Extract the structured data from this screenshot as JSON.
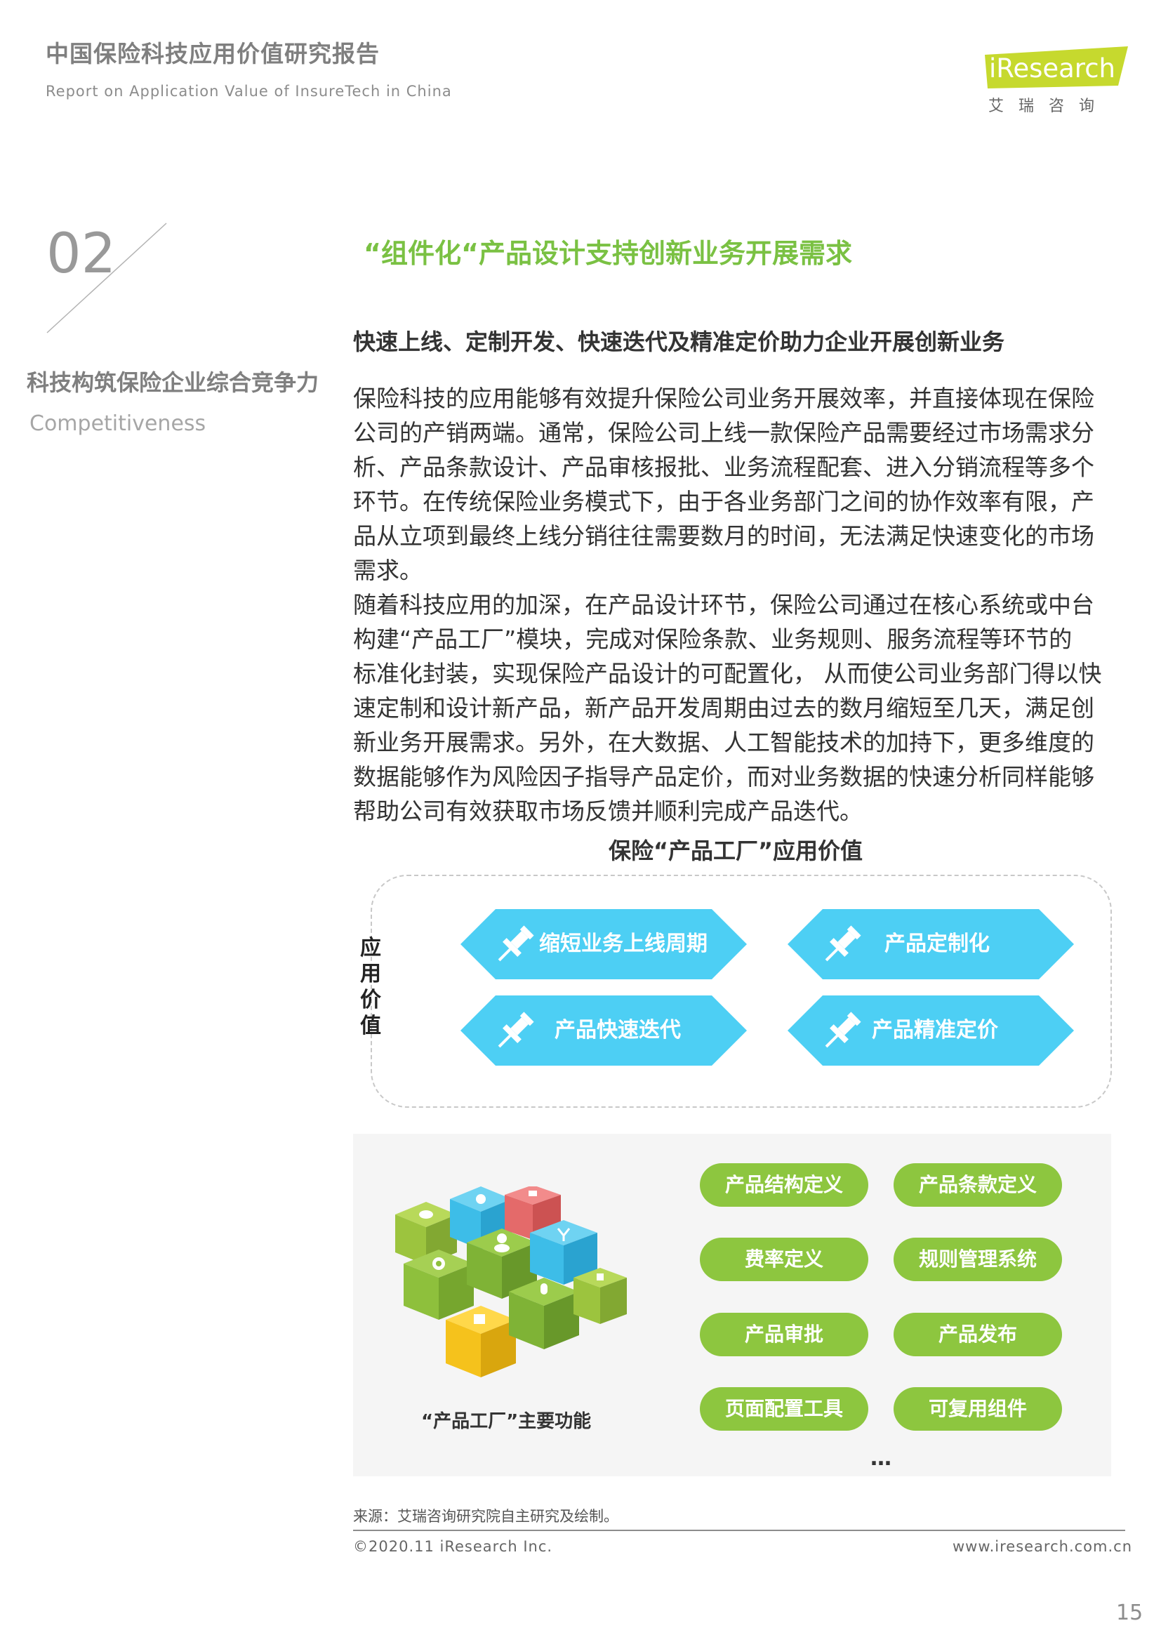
{
  "header": {
    "title": "中国保险科技应用价值研究报告",
    "subtitle": "Report on Application Value of InsureTech in China",
    "logo_word": "iResearch",
    "logo_cn": "艾瑞咨询",
    "logo_color": "#c6d92e"
  },
  "section": {
    "number": "02",
    "title_cn": "科技构筑保险企业综合竞争力",
    "title_en": "Competitiveness"
  },
  "content": {
    "title": "“组件化“产品设计支持创新业务开展需求",
    "subtitle": "快速上线、定制开发、快速迭代及精准定价助力企业开展创新业务",
    "paragraph1": [
      "保险科技的应用能够有效提升保险公司业务开展效率，并直接体现在保险",
      "公司的产销两端。通常，保险公司上线一款保险产品需要经过市场需求分",
      "析、产品条款设计、产品审核报批、业务流程配套、进入分销流程等多个",
      "环节。在传统保险业务模式下，由于各业务部门之间的协作效率有限，产",
      "品从立项到最终上线分销往往需要数月的时间，无法满足快速变化的市场",
      "需求。"
    ],
    "paragraph2": [
      "随着科技应用的加深，在产品设计环节，保险公司通过在核心系统或中台",
      "构建“产品工厂”模块，完成对保险条款、业务规则、服务流程等环节的",
      "标准化封装，实现保险产品设计的可配置化， 从而使公司业务部门得以快",
      "速定制和设计新产品，新产品开发周期由过去的数月缩短至几天，满足创",
      "新业务开展需求。另外，在大数据、人工智能技术的加持下，更多维度的",
      "数据能够作为风险因子指导产品定价，而对业务数据的快速分析同样能够",
      "帮助公司有效获取市场反馈并顺利完成产品迭代。"
    ]
  },
  "diagram": {
    "title": "保险“产品工厂”应用价值",
    "side_label": "应用价值",
    "hex_color": "#4dcff4",
    "values": [
      "缩短业务上线周期",
      "产品定制化",
      "产品快速迭代",
      "产品精准定价"
    ]
  },
  "factory": {
    "caption": "“产品工厂”主要功能",
    "pill_color": "#8dc63f",
    "functions": [
      "产品结构定义",
      "产品条款定义",
      "费率定义",
      "规则管理系统",
      "产品审批",
      "产品发布",
      "页面配置工具",
      "可复用组件"
    ],
    "ellipsis": "…"
  },
  "footer": {
    "source": "来源：艾瑞咨询研究院自主研究及绘制。",
    "copyright": "©2020.11 iResearch Inc.",
    "website": "www.iresearch.com.cn",
    "page_number": "15"
  }
}
